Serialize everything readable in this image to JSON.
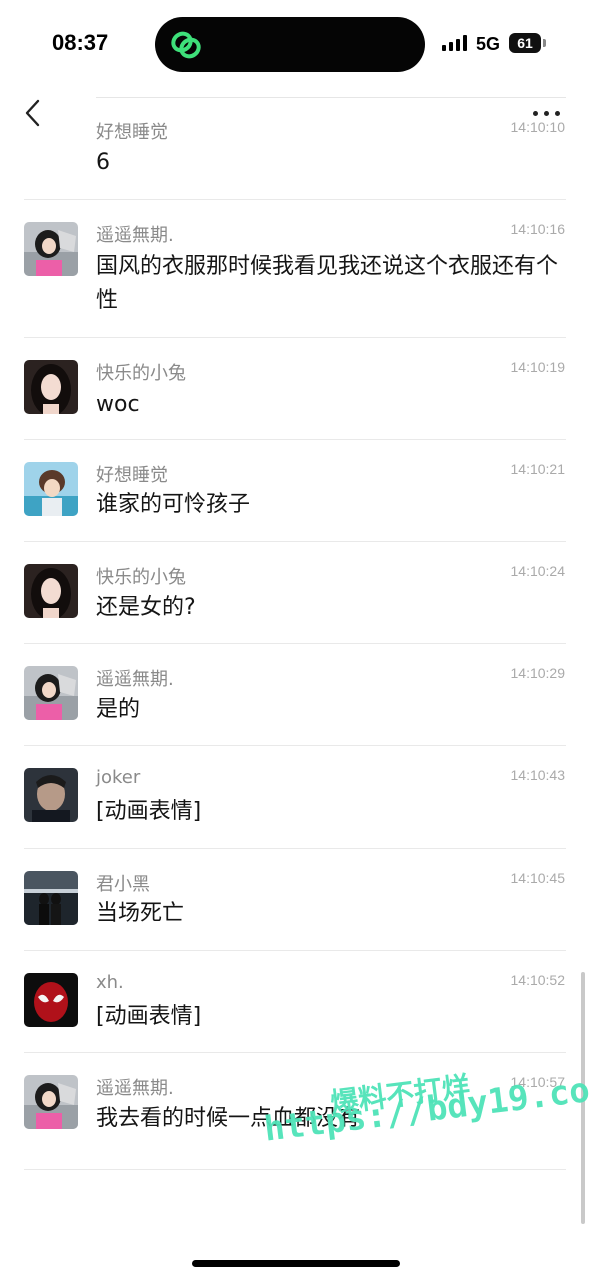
{
  "status_bar": {
    "time": "08:37",
    "network": "5G",
    "battery": "61"
  },
  "messages": [
    {
      "name": "好想睡觉",
      "time": "14:10:10",
      "text": "6",
      "avatar": "anime-boy-avatar"
    },
    {
      "name": "遥遥無期.",
      "time": "14:10:16",
      "text": "国风的衣服那时候我看见我还说这个衣服还有个性",
      "avatar": "girl-pink-top-avatar"
    },
    {
      "name": "快乐的小兔",
      "time": "14:10:19",
      "text": "woc",
      "avatar": "girl-dark-hair-avatar"
    },
    {
      "name": "好想睡觉",
      "time": "14:10:21",
      "text": "谁家的可怜孩子",
      "avatar": "anime-boy-avatar"
    },
    {
      "name": "快乐的小兔",
      "time": "14:10:24",
      "text": "还是女的?",
      "avatar": "girl-dark-hair-avatar"
    },
    {
      "name": "遥遥無期.",
      "time": "14:10:29",
      "text": "是的",
      "avatar": "girl-pink-top-avatar"
    },
    {
      "name": "joker",
      "time": "14:10:43",
      "text": "[动画表情]",
      "avatar": "man-portrait-avatar"
    },
    {
      "name": "君小黑",
      "time": "14:10:45",
      "text": "当场死亡",
      "avatar": "couple-night-avatar"
    },
    {
      "name": "xh.",
      "time": "14:10:52",
      "text": "[动画表情]",
      "avatar": "spiderman-mask-avatar"
    },
    {
      "name": "遥遥無期.",
      "time": "14:10:57",
      "text": "我去看的时候一点血都没有",
      "avatar": "girl-pink-top-avatar"
    }
  ],
  "watermark": {
    "line1": "爆料不打烊",
    "line2": "https://bdy19.co"
  },
  "colors": {
    "watermark": "#4fe3b8",
    "timestamp": "#aaaaaa",
    "name": "#8a8a8a"
  }
}
